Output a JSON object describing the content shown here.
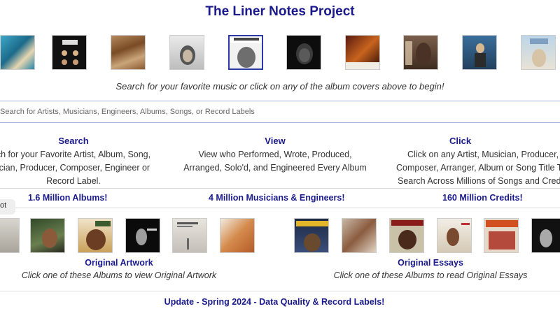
{
  "app": {
    "title": "The Liner Notes Project"
  },
  "covers_top": [
    "album-cover-1",
    "album-cover-2",
    "album-cover-3",
    "album-cover-4",
    "album-cover-5",
    "album-cover-6",
    "album-cover-7",
    "album-cover-8",
    "album-cover-9",
    "album-cover-10"
  ],
  "tagline": "Search for your favorite music or click on any of the album covers above to begin!",
  "search": {
    "placeholder": "Search for Artists, Musicians, Engineers, Albums, Songs, or Record Labels",
    "value": ""
  },
  "features": {
    "search": {
      "heading": "Search",
      "line1": "ch for your Favorite Artist, Album, Song,",
      "line2": "ician, Producer, Composer, Engineer or",
      "line3": "Record Label."
    },
    "view": {
      "heading": "View",
      "line1": "View who Performed, Wrote, Produced,",
      "line2": "Arranged, Solo'd, and Engineered Every Album"
    },
    "click": {
      "heading": "Click",
      "line1": "Click on any Artist, Musician, Producer,",
      "line2": "Composer, Arranger, Album or Song Title T",
      "line3": "Search Across Millions of Songs and Credi"
    }
  },
  "stats": {
    "albums": "1.6 Million Albums!",
    "musicians": "4 Million Musicians & Engineers!",
    "credits": "160 Million Credits!"
  },
  "toast_text": "ot",
  "original_artwork": {
    "title": "Original Artwork",
    "subtitle": "Click one of these Albums to view Original Artwork"
  },
  "original_essays": {
    "title": "Original Essays",
    "subtitle": "Click one of these Albums to read Original Essays"
  },
  "update": "Update - Spring 2024 - Data Quality & Record Labels!",
  "colors": {
    "accent": "#1a1a8c",
    "divider": "#dcdcdc",
    "search_border": "#9db3d9"
  }
}
